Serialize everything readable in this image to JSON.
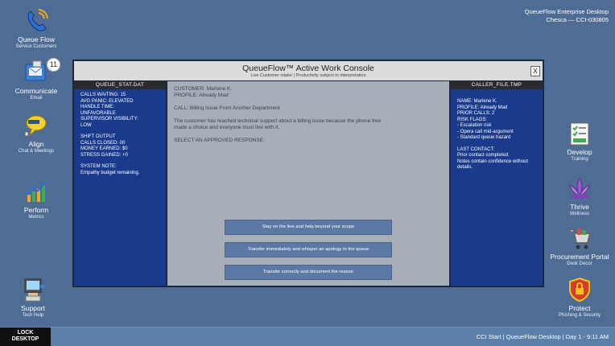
{
  "corner": {
    "line1": "QueueFlow Enterprise Desktop",
    "line2": "Chesca — CCI-030805"
  },
  "desktop_icons": {
    "queueflow": {
      "label": "Queue Flow",
      "sub": "Service Customers"
    },
    "communicate": {
      "label": "Communicate",
      "sub": "Email",
      "badge": "11"
    },
    "align": {
      "label": "Align",
      "sub": "Chat & Meetings"
    },
    "perform": {
      "label": "Perform",
      "sub": "Metrics"
    },
    "support": {
      "label": "Support",
      "sub": "Tech Help"
    },
    "develop": {
      "label": "Develop",
      "sub": "Training"
    },
    "thrive": {
      "label": "Thrive",
      "sub": "Wellness"
    },
    "procurement": {
      "label": "Procurement Portal",
      "sub": "Desk Decor"
    },
    "protect": {
      "label": "Protect",
      "sub": "Phishing & Security"
    }
  },
  "window": {
    "title": "QueueFlow™ Active Work Console",
    "subtitle": "Live Customer intake | Productivity subject to interpretation",
    "close": "X"
  },
  "left_panel": {
    "header": "QUEUE_STAT.DAT",
    "calls_waiting": "CALLS WAITING: 15",
    "avg_panic": "AVG PANIC: ELEVATED",
    "handle_time": "HANDLE TIME:",
    "handle_time_val": "UNFAVORABLE",
    "supervisor": "SUPERVISOR VISIBILITY:",
    "supervisor_val": "LOW",
    "shift_output": "SHIFT OUTPUT",
    "calls_closed": "CALLS CLOSED: 00",
    "money_earned": "MONEY EARNED: $0",
    "stress_gained": "STRESS GAINED: +0",
    "system_note": "SYSTEM NOTE:",
    "system_note_val": "Empathy budget remaining."
  },
  "center": {
    "customer": "CUSTOMER: Marlene K.",
    "profile": "PROFILE: Already Mad",
    "call": "CALL: Billing Issue From Another Department",
    "desc1": "The customer has reached technical support about a billing issue because the phone tree",
    "desc2": "made a choice and everyone must live with it.",
    "prompt": "SELECT AN APPROVED RESPONSE:",
    "responses": [
      "Stay on the line and help beyond your scope",
      "Transfer immediately and whisper an apology to the queue",
      "Transfer correctly and document the reason"
    ]
  },
  "right_panel": {
    "header": "CALLER_FILE.TMP",
    "name": "NAME: Marlene K.",
    "profile": "PROFILE: Already Mad",
    "prior": "PRIOR CALLS: 2",
    "risk": "RISK FLAGS:",
    "flag1": "- Escalation risk",
    "flag2": "- Opera call mid-argument",
    "flag3": "- Standard queue hazard",
    "last": "LAST CONTACT:",
    "last1": "Prior contact completed.",
    "last2": "Notes contain confidence without",
    "last3": "details."
  },
  "taskbar": {
    "lock_line1": "LOCK",
    "lock_line2": "DESKTOP",
    "status": "CCI Start | QueueFlow Desktop | Day 1 - 9:11 AM"
  },
  "icons": [
    "phone-icon",
    "mail-icon",
    "chat-icon",
    "chart-icon",
    "computer-icon",
    "checklist-icon",
    "lotus-icon",
    "cart-icon",
    "shield-icon"
  ]
}
